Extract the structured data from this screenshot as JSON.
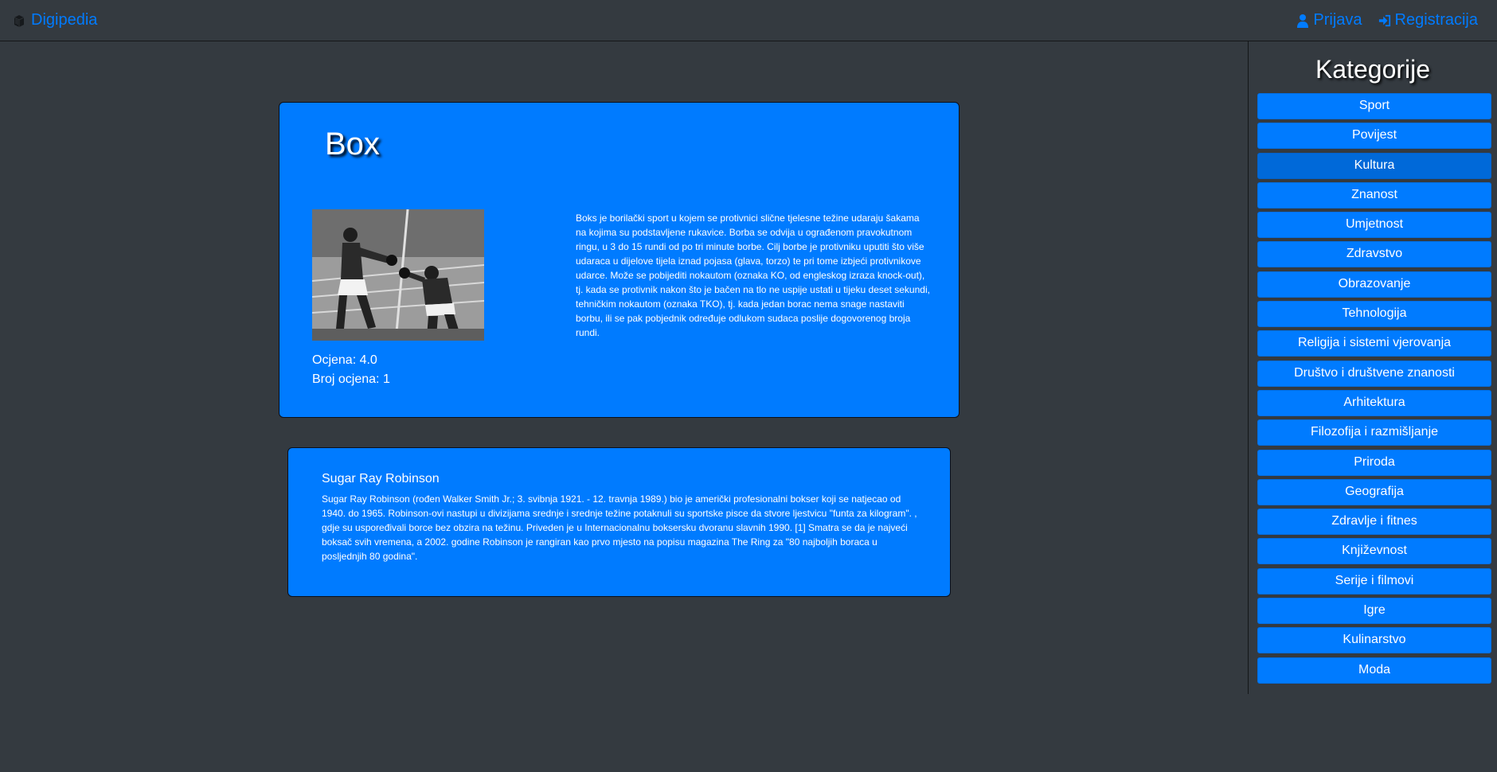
{
  "navbar": {
    "brand": "Digipedia",
    "login_label": "Prijava",
    "register_label": "Registracija"
  },
  "sidebar": {
    "title": "Kategorije",
    "categories": [
      "Sport",
      "Povijest",
      "Kultura",
      "Znanost",
      "Umjetnost",
      "Zdravstvo",
      "Obrazovanje",
      "Tehnologija",
      "Religija i sistemi vjerovanja",
      "Društvo i društvene znanosti",
      "Arhitektura",
      "Filozofija i razmišljanje",
      "Priroda",
      "Geografija",
      "Zdravlje i fitnes",
      "Književnost",
      "Serije i filmovi",
      "Igre",
      "Kulinarstvo",
      "Moda"
    ],
    "active_category": "Kultura"
  },
  "article": {
    "title": "Box",
    "rating_label": "Ocjena: 4.0",
    "rating_count_label": "Broj ocjena: 1",
    "text": "Boks je borilački sport u kojem se protivnici slične tjelesne težine udaraju šakama na kojima su podstavljene rukavice. Borba se odvija u ograđenom pravokutnom ringu, u 3 do 15 rundi od po tri minute borbe. Cilj borbe je protivniku uputiti što više udaraca u dijelove tijela iznad pojasa (glava, torzo) te pri tome izbjeći protivnikove udarce. Može se pobijediti nokautom (oznaka KO, od engleskog izraza knock-out), tj. kada se protivnik nakon što je bačen na tlo ne uspije ustati u tijeku deset sekundi, tehničkim nokautom (oznaka TKO), tj. kada jedan borac nema snage nastaviti borbu, ili se pak pobjednik određuje odlukom sudaca poslije dogovorenog broja rundi."
  },
  "comment": {
    "author": "Sugar Ray Robinson",
    "text": "Sugar Ray Robinson (rođen Walker Smith Jr.; 3. svibnja 1921. - 12. travnja 1989.) bio je američki profesionalni bokser koji se natjecao od 1940. do 1965. Robinson-ovi nastupi u divizijama srednje i srednje težine potaknuli su sportske pisce da stvore ljestvicu \"funta za kilogram\". , gdje su uspoređivali borce bez obzira na težinu. Priveden je u Internacionalnu boksersku dvoranu slavnih 1990. [1] Smatra se da je najveći boksač svih vremena, a 2002. godine Robinson je rangiran kao prvo mjesto na popisu magazina The Ring za \"80 najboljih boraca u posljednjih 80 godina\"."
  },
  "colors": {
    "background": "#343a40",
    "primary": "#007bff",
    "active": "#0069d9"
  },
  "icons": {
    "brand": "book-icon",
    "login": "user-icon",
    "register": "sign-in-icon"
  }
}
